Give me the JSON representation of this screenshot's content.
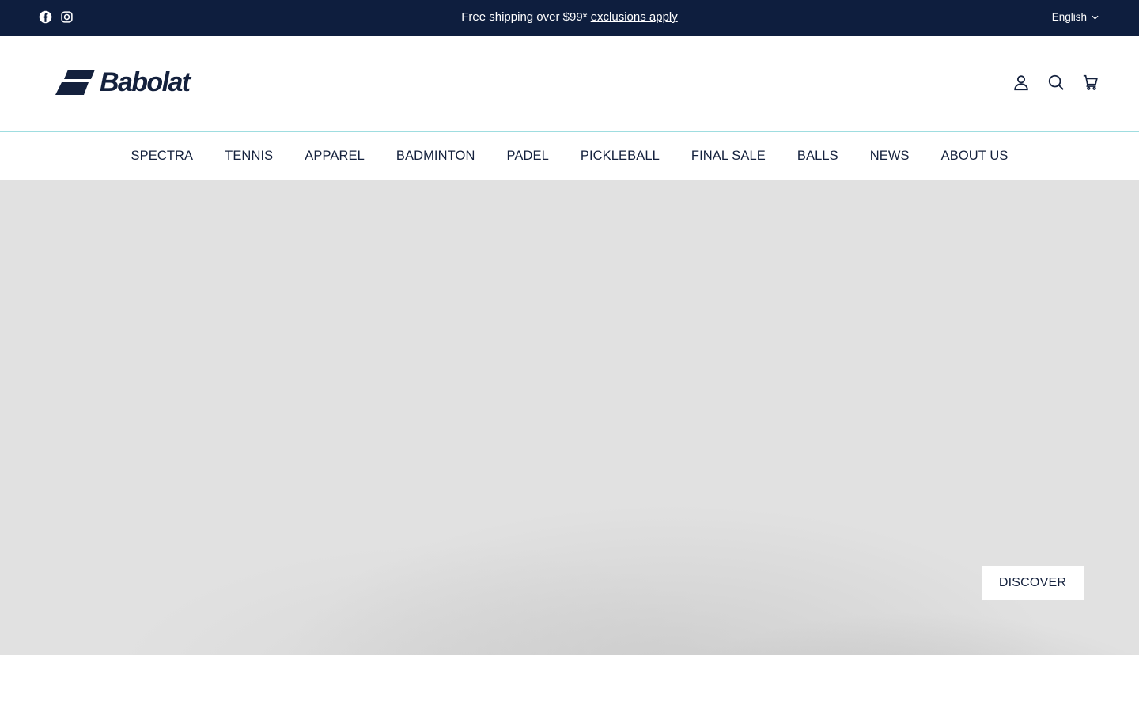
{
  "announcement": {
    "message": "Free shipping over $99*",
    "link_text": "exclusions apply",
    "social": [
      "facebook-icon",
      "instagram-icon"
    ],
    "language": "English"
  },
  "header": {
    "logo_text": "Babolat",
    "icons": [
      "account-icon",
      "search-icon",
      "cart-icon"
    ]
  },
  "nav": {
    "items": [
      {
        "label": "SPECTRA"
      },
      {
        "label": "TENNIS"
      },
      {
        "label": "APPAREL"
      },
      {
        "label": "BADMINTON"
      },
      {
        "label": "PADEL"
      },
      {
        "label": "PICKLEBALL"
      },
      {
        "label": "FINAL SALE"
      },
      {
        "label": "BALLS"
      },
      {
        "label": "NEWS"
      },
      {
        "label": "ABOUT US"
      }
    ]
  },
  "hero": {
    "cta_label": "DISCOVER"
  },
  "colors": {
    "announcement_bg": "#0e1e3e",
    "brand_navy": "#14213d",
    "divider": "#9fdde0",
    "hero_bg": "#e1e1e1"
  }
}
